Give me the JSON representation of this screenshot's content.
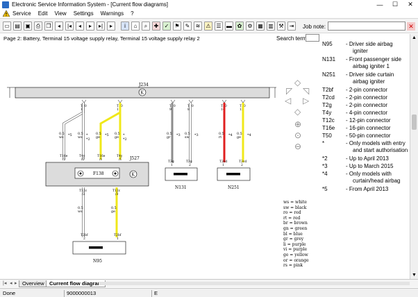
{
  "window": {
    "title": "Electronic Service Information System - [Current flow diagrams]",
    "minimize": "—",
    "maximize": "☐",
    "close": "✕"
  },
  "menu": [
    "Service",
    "Edit",
    "View",
    "Settings",
    "Warnings",
    "?"
  ],
  "toolbar": {
    "job_note_label": "Job note:",
    "job_note_value": ""
  },
  "page": {
    "title": "Page 2: Battery, Terminal 15 voltage supply relay, Terminal 15 voltage supply relay 2",
    "search_label": "Search term:",
    "search_value": ""
  },
  "legend": [
    {
      "code": "N95",
      "desc": "-  Driver side airbag"
    },
    {
      "code": "",
      "desc": "igniter"
    },
    {
      "code": "N131",
      "desc": "-  Front passenger side"
    },
    {
      "code": "",
      "desc": "airbag igniter 1"
    },
    {
      "code": "N251",
      "desc": "-  Driver side curtain"
    },
    {
      "code": "",
      "desc": "airbag igniter"
    },
    {
      "code": "T2bf",
      "desc": "-  2-pin connector"
    },
    {
      "code": "T2cd",
      "desc": "-  2-pin connector"
    },
    {
      "code": "T2g",
      "desc": "-  2-pin connector"
    },
    {
      "code": "T4y",
      "desc": "-  4-pin connector"
    },
    {
      "code": "T12c",
      "desc": "-  12-pin connector"
    },
    {
      "code": "T16e",
      "desc": "-  16-pin connector"
    },
    {
      "code": "T50",
      "desc": "-  50-pin connector"
    },
    {
      "code": "*",
      "desc": "-  Only models with entry"
    },
    {
      "code": "",
      "desc": "and start authorisation"
    },
    {
      "code": "*2",
      "desc": "-  Up to April 2013"
    },
    {
      "code": "*3",
      "desc": "-  Up to March 2015"
    },
    {
      "code": "*4",
      "desc": "-  Only models with"
    },
    {
      "code": "",
      "desc": "curtain/head airbag"
    },
    {
      "code": "*5",
      "desc": "-  From April 2013"
    }
  ],
  "diagram": {
    "bus_label": "J234",
    "module_label": "J527",
    "fuse_label": "F138",
    "components": [
      "N131",
      "N251",
      "N95"
    ],
    "wire_labels": {
      "w1": {
        "conn": "T50",
        "pin": "10",
        "size": "0.5",
        "color": "ws",
        "note": "*5"
      },
      "w2": {
        "conn": "T50",
        "pin": "11",
        "size": "0.5",
        "color": "ge",
        "note": ""
      },
      "w3": {
        "conn": "T50",
        "pin": "9",
        "size": "0.5",
        "color": "gr",
        "note": "*3"
      },
      "w4": {
        "conn": "T50",
        "pin": "8",
        "size": "0.5",
        "color": "sw",
        "note": ""
      },
      "w5": {
        "conn": "T50",
        "pin": "14",
        "size": "0.5",
        "color": "rt",
        "note": "*4"
      },
      "w6": {
        "conn": "T50",
        "pin": "15",
        "size": "0.5",
        "color": "ge",
        "note": "*4"
      }
    },
    "pins": {
      "t16e_2": "T16e",
      "t4y_2": "T4y",
      "t16e_1": "T16e",
      "t4y_1": "T4y",
      "t2g_1": "T2g",
      "t2g_2": "T2g",
      "t2cd_1": "T2cd",
      "t2cd_2": "T2cd",
      "t12c_2": "T12c",
      "t12c_3": "T12c",
      "t2bf_2": "T2bf",
      "t2bf_1": "T2bf"
    },
    "wire_colors": {
      "white": "#ffffff",
      "yellow": "#f0e81a",
      "grey": "#8c8c8c",
      "red": "#e02020"
    },
    "color_legend": [
      "ws = white",
      "sw = black",
      "ro = red",
      "rt = red",
      "br = brown",
      "gn = green",
      "bl = blue",
      "gr = grey",
      "li = purple",
      "vi = purple",
      "ge = yellow",
      "or = orange",
      "rs = pink"
    ]
  },
  "tabs": {
    "overview": "Overview",
    "current": "Current flow diagram"
  },
  "status": {
    "state": "Done",
    "code": "9000000013",
    "mode": "E"
  }
}
